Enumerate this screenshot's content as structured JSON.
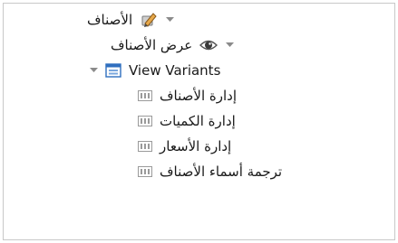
{
  "tree": {
    "root": {
      "label": "الأصناف",
      "icon": "pencil-icon"
    },
    "group": {
      "label": "عرض الأصناف",
      "icon": "eye-icon"
    },
    "variants": {
      "label": "View Variants",
      "icon": "window-icon"
    },
    "items": [
      {
        "label": "إدارة الأصناف",
        "icon": "grid-icon"
      },
      {
        "label": "إدارة الكميات",
        "icon": "grid-icon"
      },
      {
        "label": "إدارة الأسعار",
        "icon": "grid-icon"
      },
      {
        "label": "ترجمة أسماء الأصناف",
        "icon": "grid-icon"
      }
    ]
  },
  "colors": {
    "chevron": "#8a8a8a",
    "window_icon": "#2f6fbf",
    "grid_icon": "#9a9a9a",
    "panel_border": "#c8c8c8"
  }
}
